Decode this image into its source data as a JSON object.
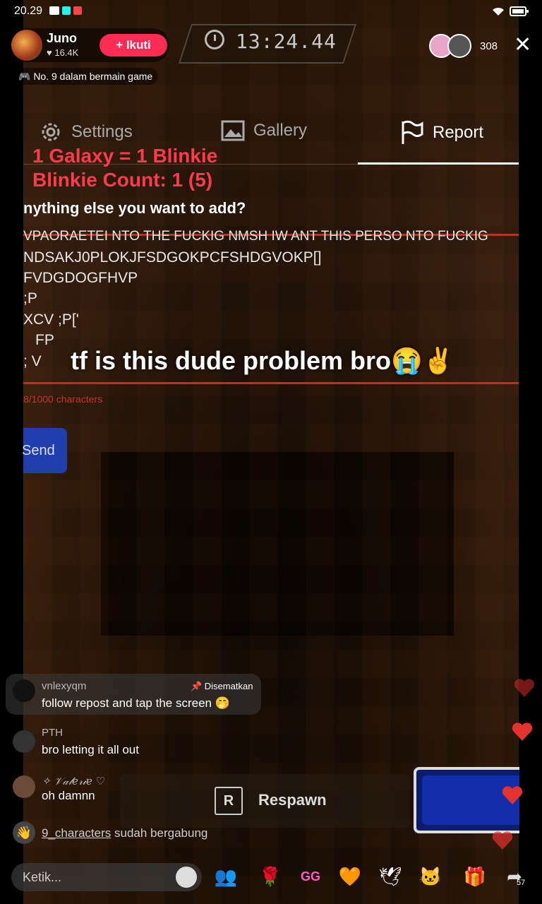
{
  "status_bar": {
    "time": "20.29"
  },
  "host": {
    "name": "Juno",
    "likes": "16.4K",
    "follow_label": "+ Ikuti",
    "rank_tag": "🎮 No. 9 dalam bermain game"
  },
  "timer": "13:24.44",
  "viewers": {
    "count": "308"
  },
  "report_form": {
    "tabs": [
      {
        "label": "Settings",
        "icon": "gear-icon"
      },
      {
        "label": "Gallery",
        "icon": "image-icon"
      },
      {
        "label": "Report",
        "icon": "flag-icon"
      }
    ],
    "active_tab": "Report",
    "galaxy_line1": "1 Galaxy = 1 Blinkie",
    "galaxy_line2": "Blinkie Count: 1 (5)",
    "question": "nything else you want to add?",
    "typed_lines": [
      "VPAORAETEI NTO THE FUCKIG NMSH IW ANT THIS PERSO NTO FUCKIG",
      "NDSAKJ0PLOKJFSDGOKPCFSHDGVOKP[]",
      "FVDGDOGFHVP",
      ";P",
      "XCV ;P['",
      "FP",
      "; V"
    ],
    "char_count": "8/1000 characters",
    "send_label": "Send"
  },
  "overlay_caption": "tf is this dude problem bro😭✌️",
  "comments": [
    {
      "user": "vnlexyqm",
      "text": "follow repost and tap the screen 🤭",
      "pinned_label": "📌 Disematkan"
    },
    {
      "user": "PTH",
      "text": "bro letting it all out"
    },
    {
      "user": "✧ 𝒱𝒶𝓁𝑒𝓇𝒾𝑒 ♡",
      "text": "oh damnn"
    }
  ],
  "join_notice": {
    "user": "9_characters",
    "text": "sudah bergabung"
  },
  "game_ui": {
    "respawn_key": "R",
    "respawn_label": "Respawn"
  },
  "bottom_bar": {
    "input_placeholder": "Ketik...",
    "share_count": "57"
  },
  "colors": {
    "accent_red": "#fe2c55",
    "report_red": "#ff3b4e",
    "send_blue": "#1f3fae"
  }
}
